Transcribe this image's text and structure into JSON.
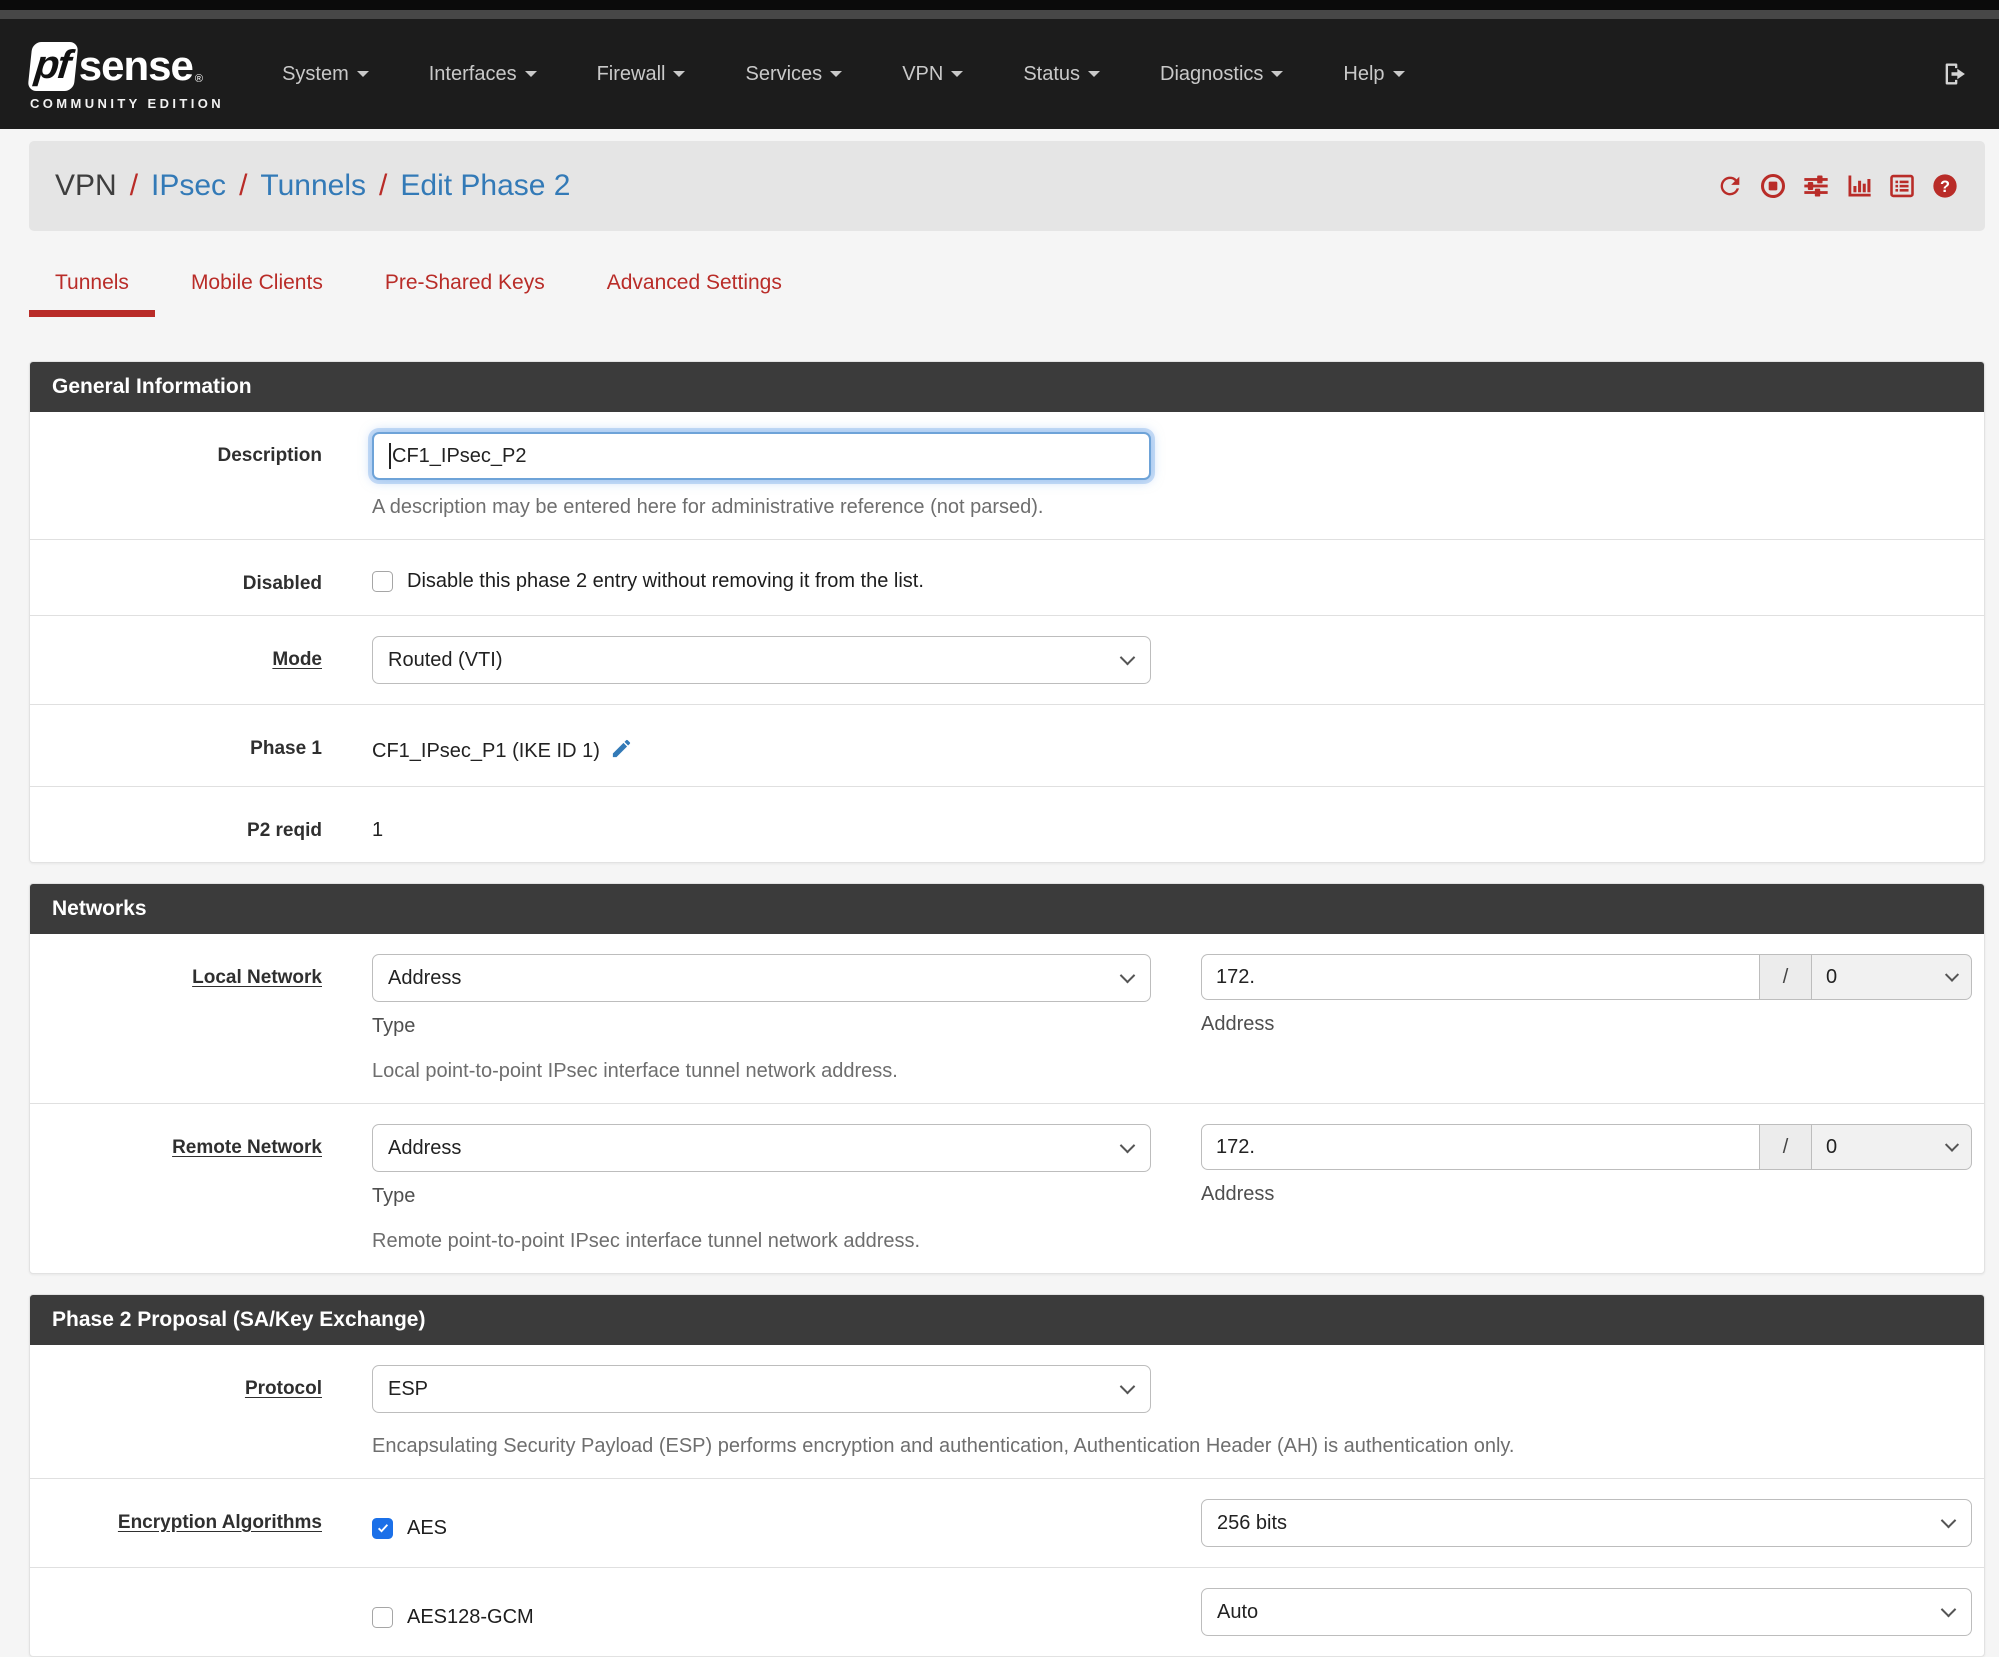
{
  "colors": {
    "accent_red": "#b92c28",
    "link_blue": "#337ab7",
    "checkbox_blue": "#1b70e8",
    "panel_header": "#3b3b3b"
  },
  "navbar": {
    "logo": {
      "pf": "pf",
      "sense": "sense",
      "registered": "®",
      "subtitle": "COMMUNITY EDITION"
    },
    "items": [
      {
        "label": "System"
      },
      {
        "label": "Interfaces"
      },
      {
        "label": "Firewall"
      },
      {
        "label": "Services"
      },
      {
        "label": "VPN"
      },
      {
        "label": "Status"
      },
      {
        "label": "Diagnostics"
      },
      {
        "label": "Help"
      }
    ]
  },
  "breadcrumb": {
    "current": "VPN",
    "separator": "/",
    "links": [
      {
        "label": "IPsec"
      },
      {
        "label": "Tunnels"
      },
      {
        "label": "Edit Phase 2"
      }
    ],
    "actions": [
      "refresh",
      "stop",
      "sliders",
      "bar-chart",
      "log",
      "help"
    ]
  },
  "tabs": [
    {
      "label": "Tunnels",
      "active": true
    },
    {
      "label": "Mobile Clients",
      "active": false
    },
    {
      "label": "Pre-Shared Keys",
      "active": false
    },
    {
      "label": "Advanced Settings",
      "active": false
    }
  ],
  "general": {
    "title": "General Information",
    "description": {
      "label": "Description",
      "value": "CF1_IPsec_P2",
      "help": "A description may be entered here for administrative reference (not parsed)."
    },
    "disabled": {
      "label": "Disabled",
      "checkbox_label": "Disable this phase 2 entry without removing it from the list.",
      "checked": false
    },
    "mode": {
      "label": "Mode",
      "value": "Routed (VTI)"
    },
    "phase1": {
      "label": "Phase 1",
      "value": "CF1_IPsec_P1 (IKE ID 1)"
    },
    "p2reqid": {
      "label": "P2 reqid",
      "value": "1"
    }
  },
  "networks": {
    "title": "Networks",
    "local": {
      "label": "Local Network",
      "type_value": "Address",
      "type_caption": "Type",
      "address_value": "172.",
      "address_caption": "Address",
      "slash": "/",
      "prefix_value": "0",
      "help": "Local point-to-point IPsec interface tunnel network address."
    },
    "remote": {
      "label": "Remote Network",
      "type_value": "Address",
      "type_caption": "Type",
      "address_value": "172.",
      "address_caption": "Address",
      "slash": "/",
      "prefix_value": "0",
      "help": "Remote point-to-point IPsec interface tunnel network address."
    }
  },
  "proposal": {
    "title": "Phase 2 Proposal (SA/Key Exchange)",
    "protocol": {
      "label": "Protocol",
      "value": "ESP",
      "help": "Encapsulating Security Payload (ESP) performs encryption and authentication, Authentication Header (AH) is authentication only."
    },
    "encryption": {
      "label": "Encryption Algorithms",
      "rows": [
        {
          "name": "AES",
          "checked": true,
          "bits": "256 bits"
        },
        {
          "name": "AES128-GCM",
          "checked": false,
          "bits": "Auto"
        }
      ]
    }
  }
}
